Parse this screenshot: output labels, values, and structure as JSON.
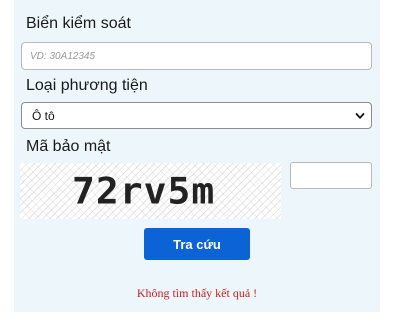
{
  "form": {
    "plate": {
      "label": "Biển kiểm soát",
      "placeholder": "VD: 30A12345",
      "value": ""
    },
    "vehicle_type": {
      "label": "Loại phương tiện",
      "selected": "Ô tô",
      "icon": "chevron-down-icon"
    },
    "captcha": {
      "label": "Mã bảo mật",
      "image_text": "72rv5m",
      "answer_value": ""
    },
    "submit_label": "Tra cứu",
    "result_message": "Không tìm thấy kết quả !"
  },
  "colors": {
    "panel_bg": "#edf7fb",
    "button_bg": "#0b63d6",
    "error_text": "#cc1f1f"
  }
}
